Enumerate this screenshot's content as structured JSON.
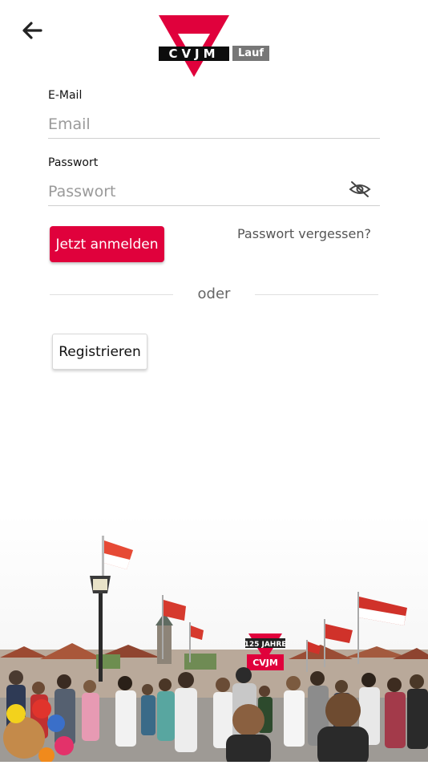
{
  "logo": {
    "wordmark": "CVJM",
    "badge": "Lauf"
  },
  "form": {
    "email": {
      "label": "E-Mail",
      "placeholder": "Email"
    },
    "password": {
      "label": "Passwort",
      "placeholder": "Passwort"
    },
    "login_label": "Jetzt anmelden",
    "forgot_label": "Passwort vergessen?",
    "divider_label": "oder",
    "register_label": "Registrieren"
  },
  "hero": {
    "banner_text": "125 JAHRE",
    "banner_logo": "CVJM"
  },
  "icons": {
    "back": "arrow-left-icon",
    "visibility": "eye-off-icon"
  },
  "colors": {
    "accent": "#e0013c",
    "logo_black": "#0d0d0d",
    "badge_grey": "#777777"
  }
}
